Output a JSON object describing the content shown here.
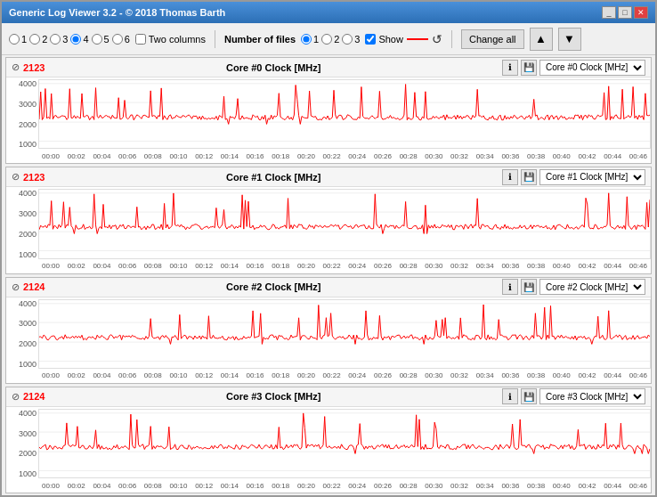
{
  "window": {
    "title": "Generic Log Viewer 3.2 - © 2018 Thomas Barth",
    "buttons": [
      "minimize",
      "maximize",
      "close"
    ]
  },
  "toolbar": {
    "radio_columns": {
      "options": [
        "1",
        "2",
        "3",
        "4",
        "5",
        "6"
      ],
      "selected": "4"
    },
    "two_columns_label": "Two columns",
    "two_columns_checked": false,
    "num_files_label": "Number of files",
    "num_files_options": [
      "1",
      "2",
      "3"
    ],
    "num_files_selected": "1",
    "show_label": "Show",
    "change_all_label": "Change all",
    "up_label": "▲",
    "down_label": "▼"
  },
  "charts": [
    {
      "id": "core0",
      "value": "2123",
      "title": "Core #0 Clock [MHz]",
      "dropdown": "Core #0 Clock [MHz]",
      "y_max": "4000",
      "y_mid_high": "3000",
      "y_mid": "2000",
      "y_min": "1000",
      "x_labels": [
        "00:00",
        "00:02",
        "00:04",
        "00:06",
        "00:08",
        "00:10",
        "00:12",
        "00:14",
        "00:16",
        "00:18",
        "00:20",
        "00:22",
        "00:24",
        "00:26",
        "00:28",
        "00:30",
        "00:32",
        "00:34",
        "00:36",
        "00:38",
        "00:40",
        "00:42",
        "00:44",
        "00:46"
      ]
    },
    {
      "id": "core1",
      "value": "2123",
      "title": "Core #1 Clock [MHz]",
      "dropdown": "Core #1 Clock [MHz]",
      "y_max": "4000",
      "y_mid_high": "3000",
      "y_mid": "2000",
      "y_min": "1000",
      "x_labels": [
        "00:00",
        "00:02",
        "00:04",
        "00:06",
        "00:08",
        "00:10",
        "00:12",
        "00:14",
        "00:16",
        "00:18",
        "00:20",
        "00:22",
        "00:24",
        "00:26",
        "00:28",
        "00:30",
        "00:32",
        "00:34",
        "00:36",
        "00:38",
        "00:40",
        "00:42",
        "00:44",
        "00:46"
      ]
    },
    {
      "id": "core2",
      "value": "2124",
      "title": "Core #2 Clock [MHz]",
      "dropdown": "Core #2 Clock [MHz]",
      "y_max": "4000",
      "y_mid_high": "3000",
      "y_mid": "2000",
      "y_min": "1000",
      "x_labels": [
        "00:00",
        "00:02",
        "00:04",
        "00:06",
        "00:08",
        "00:10",
        "00:12",
        "00:14",
        "00:16",
        "00:18",
        "00:20",
        "00:22",
        "00:24",
        "00:26",
        "00:28",
        "00:30",
        "00:32",
        "00:34",
        "00:36",
        "00:38",
        "00:40",
        "00:42",
        "00:44",
        "00:46"
      ]
    },
    {
      "id": "core3",
      "value": "2124",
      "title": "Core #3 Clock [MHz]",
      "dropdown": "Core #3 Clock [MHz]",
      "y_max": "4000",
      "y_mid_high": "3000",
      "y_mid": "2000",
      "y_min": "1000",
      "x_labels": [
        "00:00",
        "00:02",
        "00:04",
        "00:06",
        "00:08",
        "00:10",
        "00:12",
        "00:14",
        "00:16",
        "00:18",
        "00:20",
        "00:22",
        "00:24",
        "00:26",
        "00:28",
        "00:30",
        "00:32",
        "00:34",
        "00:36",
        "00:38",
        "00:40",
        "00:42",
        "00:44",
        "00:46"
      ]
    }
  ]
}
